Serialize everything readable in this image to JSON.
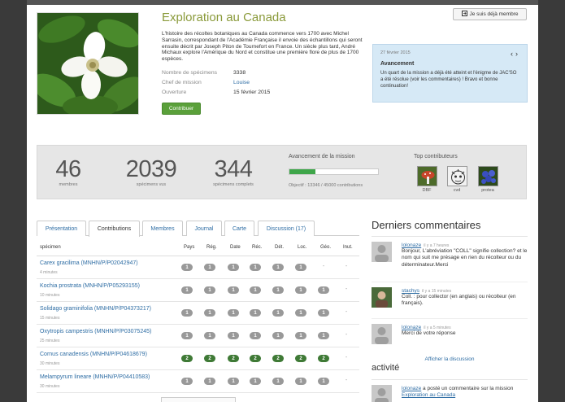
{
  "mission": {
    "title": "Exploration au Canada",
    "description": "L'histoire des récoltes botaniques au Canada commence vers 1700 avec Michel Sarrasin, correspondant de l'Académie Française il envoie des échantillons qui seront ensuite décrit par Joseph Piton de Tournefort en France. Un siècle plus tard, André Michaux explore l'Amérique du Nord et constitue une première flore de plus de 1700 espèces.",
    "meta": [
      {
        "label": "Nombre de spécimens",
        "value": "3338"
      },
      {
        "label": "Chef de mission",
        "value": "Louise"
      },
      {
        "label": "Ouverture",
        "value": "15 février 2015"
      }
    ],
    "contribute_label": "Contribuer"
  },
  "header": {
    "member_button": "Je suis déjà membre"
  },
  "news": {
    "date": "27 février 2015",
    "title": "Avancement",
    "text": "Un quart de la mission a déjà été atteint et l'énigme de JAC'SO a été résolue (voir les commentaires) ! Bravo et bonne continuation!"
  },
  "stats": {
    "members": {
      "value": "46",
      "label": "membres"
    },
    "seen": {
      "value": "2039",
      "label": "spécimens vus"
    },
    "complete": {
      "value": "344",
      "label": "spécimens complets"
    },
    "progress_label": "Avancement de la mission",
    "progress_fraction": 0.2966,
    "progress_text": "Objectif : 13346 / 45000 contributions",
    "top_label": "Top contributeurs",
    "contributors": [
      "DBF",
      "cvd",
      "protea"
    ]
  },
  "tabs": [
    "Présentation",
    "Contributions",
    "Membres",
    "Journal",
    "Carte",
    "Discussion (17)"
  ],
  "table": {
    "headers": [
      "spécimen",
      "Pays",
      "Rég.",
      "Date",
      "Réc.",
      "Dét.",
      "Loc.",
      "Géo.",
      "Inut."
    ],
    "rows": [
      {
        "name": "Carex gracilima (MNHN/P/P02042947)",
        "time": "4 minutes",
        "cells": [
          "1",
          "1",
          "1",
          "1",
          "1",
          "1",
          "-",
          "-"
        ]
      },
      {
        "name": "Kochia prostrata (MNHN/P/P05293155)",
        "time": "10 minutes",
        "cells": [
          "1",
          "1",
          "1",
          "1",
          "1",
          "1",
          "1",
          "-"
        ]
      },
      {
        "name": "Solidago graminifolia (MNHN/P/P04373217)",
        "time": "15 minutes",
        "cells": [
          "1",
          "1",
          "1",
          "1",
          "1",
          "1",
          "1",
          "-"
        ]
      },
      {
        "name": "Oxytropis campestris (MNHN/P/P03075245)",
        "time": "25 minutes",
        "cells": [
          "1",
          "1",
          "1",
          "1",
          "1",
          "1",
          "1",
          "-"
        ]
      },
      {
        "name": "Cornus canadensis (MNHN/P/P04618679)",
        "time": "30 minutes",
        "cells": [
          "2",
          "2",
          "2",
          "2",
          "2",
          "2",
          "2",
          "-"
        ]
      },
      {
        "name": "Melampyrum lineare (MNHN/P/P04410583)",
        "time": "30 minutes",
        "cells": [
          "1",
          "1",
          "1",
          "1",
          "1",
          "1",
          "1",
          "-"
        ]
      }
    ]
  },
  "comments": {
    "title": "Derniers commentaires",
    "items": [
      {
        "user": "lolonaze",
        "time": "il y a 7 heures",
        "text": "Bonjour, L'abréviation \"COLL\" signifie collection? et le nom qui suit me présage en rien du récolteur ou du déterminateur.Merci"
      },
      {
        "user": "stachys",
        "time": "il y a 15 minutes",
        "text": "Coll. : pour collector (en anglais) ou récolteur (en français)."
      },
      {
        "user": "lolonaze",
        "time": "il y a 5 minutes",
        "text": "Merci de votre réponse"
      }
    ],
    "show_all": "Afficher la discussion"
  },
  "activity": {
    "title": "activité",
    "user": "lolonaze",
    "text": "a posté un commentaire sur la mission",
    "link": "Exploration au Canada"
  }
}
